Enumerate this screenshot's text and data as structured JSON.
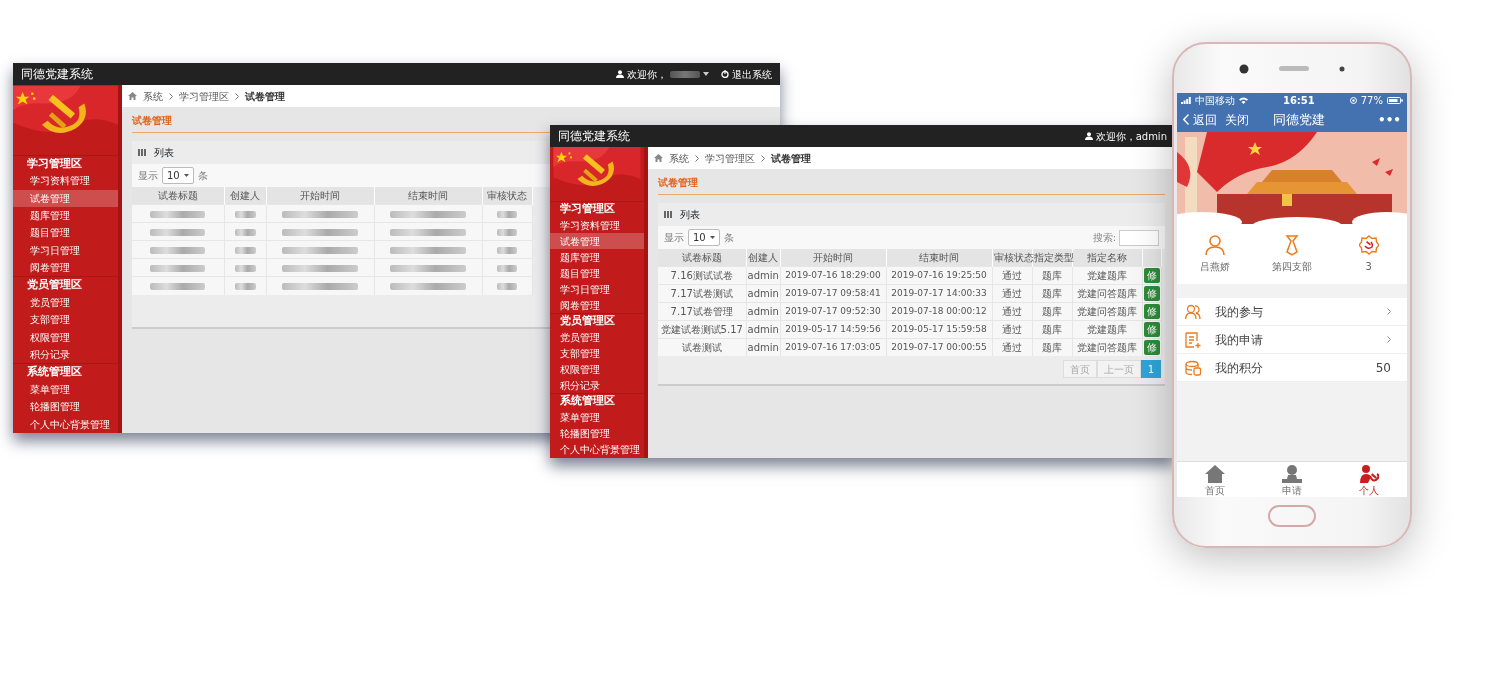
{
  "windows": [
    {
      "title": "同德党建系统",
      "header_right": [
        {
          "kind": "user",
          "text": "欢迎你，",
          "blurred_name": true,
          "caret": true
        },
        {
          "kind": "logout",
          "text": "退出系统"
        }
      ],
      "sidebar": [
        {
          "heading": "学习管理区",
          "items": [
            {
              "label": "学习资料管理",
              "selected": false
            },
            {
              "label": "试卷管理",
              "selected": true
            },
            {
              "label": "题库管理",
              "selected": false
            },
            {
              "label": "题目管理",
              "selected": false
            },
            {
              "label": "学习日管理",
              "selected": false
            },
            {
              "label": "阅卷管理",
              "selected": false
            }
          ]
        },
        {
          "heading": "党员管理区",
          "items": [
            {
              "label": "党员管理",
              "selected": false
            },
            {
              "label": "支部管理",
              "selected": false
            },
            {
              "label": "权限管理",
              "selected": false
            },
            {
              "label": "积分记录",
              "selected": false
            }
          ]
        },
        {
          "heading": "系统管理区",
          "items": [
            {
              "label": "菜单管理",
              "selected": false
            },
            {
              "label": "轮播图管理",
              "selected": false
            },
            {
              "label": "个人中心背景管理",
              "selected": false
            }
          ]
        }
      ],
      "breadcrumb": [
        "系统",
        "学习管理区",
        "试卷管理"
      ],
      "page_title": "试卷管理",
      "panel_title": "列表",
      "length_menu": {
        "prefix": "显示",
        "value": "10",
        "suffix": "条"
      },
      "table": {
        "columns": [
          "试卷标题",
          "创建人",
          "开始时间",
          "结束时间",
          "审核状态"
        ],
        "rows": [
          {
            "kind": "blurred"
          },
          {
            "kind": "blurred"
          },
          {
            "kind": "blurred"
          },
          {
            "kind": "blurred"
          },
          {
            "kind": "blurred"
          }
        ]
      }
    },
    {
      "title": "同德党建系统",
      "header_right": [
        {
          "kind": "user",
          "text": "欢迎你，admin",
          "blurred_name": false,
          "caret": false
        }
      ],
      "sidebar": [
        {
          "heading": "学习管理区",
          "items": [
            {
              "label": "学习资料管理",
              "selected": false
            },
            {
              "label": "试卷管理",
              "selected": true
            },
            {
              "label": "题库管理",
              "selected": false
            },
            {
              "label": "题目管理",
              "selected": false
            },
            {
              "label": "学习日管理",
              "selected": false
            },
            {
              "label": "阅卷管理",
              "selected": false
            }
          ]
        },
        {
          "heading": "党员管理区",
          "items": [
            {
              "label": "党员管理",
              "selected": false
            },
            {
              "label": "支部管理",
              "selected": false
            },
            {
              "label": "权限管理",
              "selected": false
            },
            {
              "label": "积分记录",
              "selected": false
            }
          ]
        },
        {
          "heading": "系统管理区",
          "items": [
            {
              "label": "菜单管理",
              "selected": false
            },
            {
              "label": "轮播图管理",
              "selected": false
            },
            {
              "label": "个人中心背景管理",
              "selected": false
            }
          ]
        }
      ],
      "breadcrumb": [
        "系统",
        "学习管理区",
        "试卷管理"
      ],
      "page_title": "试卷管理",
      "panel_title": "列表",
      "length_menu": {
        "prefix": "显示",
        "value": "10",
        "suffix": "条"
      },
      "search_label": "搜索:",
      "table": {
        "columns": [
          "试卷标题",
          "创建人",
          "开始时间",
          "结束时间",
          "审核状态",
          "指定类型",
          "指定名称"
        ],
        "rows": [
          {
            "kind": "data",
            "cells": [
              "7.16测试试卷",
              "admin",
              "2019-07-16 18:29:00",
              "2019-07-16 19:25:50",
              "通过",
              "题库",
              "党建题库"
            ],
            "action": "修"
          },
          {
            "kind": "data",
            "cells": [
              "7.17试卷测试",
              "admin",
              "2019-07-17 09:58:41",
              "2019-07-17 14:00:33",
              "通过",
              "题库",
              "党建问答题库"
            ],
            "action": "修"
          },
          {
            "kind": "data",
            "cells": [
              "7.17试卷管理",
              "admin",
              "2019-07-17 09:52:30",
              "2019-07-18 00:00:12",
              "通过",
              "题库",
              "党建问答题库"
            ],
            "action": "修"
          },
          {
            "kind": "data",
            "cells": [
              "党建试卷测试5.17",
              "admin",
              "2019-05-17 14:59:56",
              "2019-05-17 15:59:58",
              "通过",
              "题库",
              "党建题库"
            ],
            "action": "修"
          },
          {
            "kind": "data",
            "cells": [
              "试卷测试",
              "admin",
              "2019-07-16 17:03:05",
              "2019-07-17 00:00:55",
              "通过",
              "题库",
              "党建问答题库"
            ],
            "action": "修"
          }
        ]
      },
      "pager": [
        {
          "label": "首页",
          "selected": false
        },
        {
          "label": "上一页",
          "selected": false
        },
        {
          "label": "1",
          "selected": true
        }
      ]
    }
  ],
  "phone": {
    "status_bar": {
      "carrier": "中国移动",
      "time": "16:51",
      "battery": "77%"
    },
    "nav": {
      "back": "返回",
      "close": "关闭",
      "title": "同德党建",
      "more": "•••"
    },
    "profile": [
      {
        "kind": "person",
        "text": "吕燕娇"
      },
      {
        "kind": "tie",
        "text": "第四支部"
      },
      {
        "kind": "emblem",
        "text": "3"
      }
    ],
    "menu": [
      {
        "kind": "link",
        "label": "我的参与"
      },
      {
        "kind": "link",
        "label": "我的申请"
      },
      {
        "kind": "value",
        "label": "我的积分",
        "value": "50"
      }
    ],
    "tabbar": [
      {
        "kind": "home",
        "label": "首页",
        "selected": false
      },
      {
        "kind": "person",
        "label": "申请",
        "selected": false
      },
      {
        "kind": "emblem",
        "label": "个人",
        "selected": true
      }
    ]
  }
}
